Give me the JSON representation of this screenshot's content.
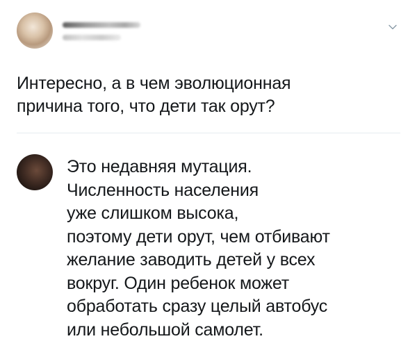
{
  "tweet": {
    "question_lines": [
      "Интересно, а в чем эволюционная",
      "причина того, что дети так орут?"
    ]
  },
  "reply": {
    "lines": [
      "Это недавняя мутация.",
      "Численность населения",
      "уже слишком высока,",
      "поэтому дети орут, чем отбивают",
      "желание заводить детей у всех",
      "вокруг. Один ребенок может",
      "обработать сразу целый автобус",
      "или небольшой самолет."
    ]
  },
  "icons": {
    "menu": "chevron-down-icon"
  },
  "colors": {
    "text": "#14171a",
    "divider": "#e6ecf0",
    "chevron": "#8899a6"
  }
}
